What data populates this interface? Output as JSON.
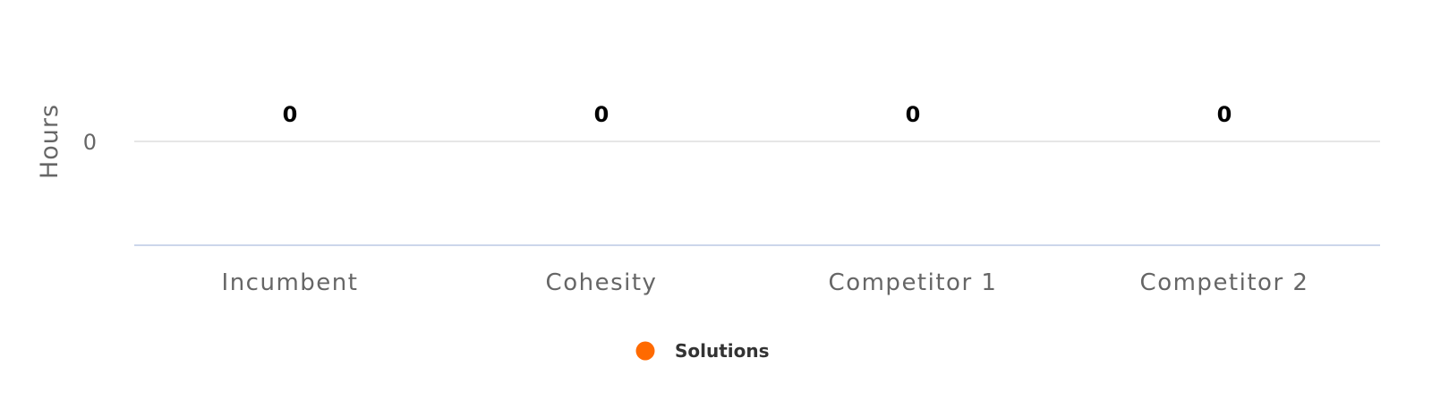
{
  "chart_data": {
    "type": "bar",
    "categories": [
      "Incumbent",
      "Cohesity",
      "Competitor 1",
      "Competitor 2"
    ],
    "series": [
      {
        "name": "Solutions",
        "values": [
          0,
          0,
          0,
          0
        ],
        "color": "#ff6a00"
      }
    ],
    "data_labels": [
      "0",
      "0",
      "0",
      "0"
    ],
    "ylabel": "Hours",
    "y_ticks": [
      "0"
    ],
    "ylim": [
      0,
      0
    ],
    "grid": true,
    "legend_position": "bottom-center",
    "colors": {
      "gridline": "#e6e6e6",
      "axis_line": "#ccd6eb",
      "tick_text": "#666666",
      "data_label_text": "#000000",
      "legend_text": "#333333"
    }
  }
}
